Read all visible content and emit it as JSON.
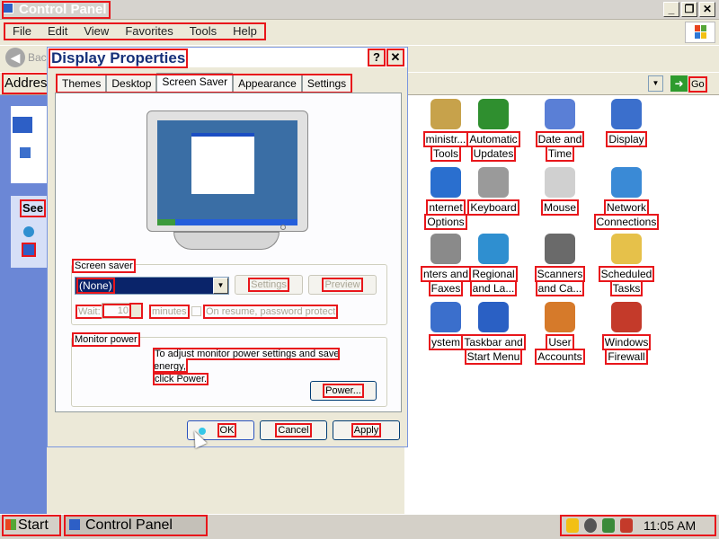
{
  "window": {
    "title": "Control Panel",
    "menus": [
      "File",
      "Edit",
      "View",
      "Favorites",
      "Tools",
      "Help"
    ],
    "back_label": "Back",
    "address_label": "Address",
    "go_label": "Go",
    "see_also_label": "See"
  },
  "control_panel_items": [
    {
      "label": "Administrative Tools",
      "display": [
        "ministr...",
        "Tools"
      ],
      "icon": "admin-tools-icon",
      "color": "#c7a24b"
    },
    {
      "label": "Automatic Updates",
      "display": [
        "Automatic",
        "Updates"
      ],
      "icon": "windows-update-icon",
      "color": "#2f8f2f"
    },
    {
      "label": "Date and Time",
      "display": [
        "Date and",
        "Time"
      ],
      "icon": "clock-icon",
      "color": "#5a7fd6"
    },
    {
      "label": "Display",
      "display": [
        "Display"
      ],
      "icon": "display-icon",
      "color": "#3b6fcc"
    },
    {
      "label": "Internet Options",
      "display": [
        "nternet",
        "Options"
      ],
      "icon": "globe-icon",
      "color": "#2a6fcf"
    },
    {
      "label": "Keyboard",
      "display": [
        "Keyboard"
      ],
      "icon": "keyboard-icon",
      "color": "#9a9a9a"
    },
    {
      "label": "Mouse",
      "display": [
        "Mouse"
      ],
      "icon": "mouse-icon",
      "color": "#d0d0d0"
    },
    {
      "label": "Network Connections",
      "display": [
        "Network",
        "Connections"
      ],
      "icon": "network-icon",
      "color": "#3a8ad6"
    },
    {
      "label": "Printers and Faxes",
      "display": [
        "nters and",
        "Faxes"
      ],
      "icon": "printer-icon",
      "color": "#8a8a8a"
    },
    {
      "label": "Regional and Language",
      "display": [
        "Regional",
        "and La..."
      ],
      "icon": "regional-icon",
      "color": "#2f8fd0"
    },
    {
      "label": "Scanners and Cameras",
      "display": [
        "Scanners",
        "and Ca..."
      ],
      "icon": "scanner-icon",
      "color": "#6a6a6a"
    },
    {
      "label": "Scheduled Tasks",
      "display": [
        "Scheduled",
        "Tasks"
      ],
      "icon": "folder-clock-icon",
      "color": "#e6c14a"
    },
    {
      "label": "System",
      "display": [
        "ystem"
      ],
      "icon": "system-icon",
      "color": "#3b6fcc"
    },
    {
      "label": "Taskbar and Start Menu",
      "display": [
        "Taskbar and",
        "Start Menu"
      ],
      "icon": "taskbar-icon",
      "color": "#2a60c4"
    },
    {
      "label": "User Accounts",
      "display": [
        "User",
        "Accounts"
      ],
      "icon": "users-icon",
      "color": "#d67a2a"
    },
    {
      "label": "Windows Firewall",
      "display": [
        "Windows",
        "Firewall"
      ],
      "icon": "firewall-icon",
      "color": "#c43a2a"
    }
  ],
  "dialog": {
    "title": "Display Properties",
    "help_label": "?",
    "close_label": "✕",
    "tabs": [
      "Themes",
      "Desktop",
      "Screen Saver",
      "Appearance",
      "Settings"
    ],
    "active_tab": "Screen Saver",
    "screen_saver": {
      "group_label": "Screen saver",
      "selected": "(None)",
      "settings_button": "Settings",
      "preview_button": "Preview",
      "wait_label": "Wait:",
      "wait_value": "10",
      "minutes_label": "minutes",
      "resume_label": "On resume, password protect"
    },
    "monitor_power": {
      "group_label": "Monitor power",
      "line1": "To adjust monitor power settings and save energy,",
      "line2": "click Power.",
      "power_button": "Power..."
    },
    "buttons": {
      "ok": "OK",
      "cancel": "Cancel",
      "apply": "Apply"
    }
  },
  "taskbar": {
    "start_label": "Start",
    "task_label": "Control Panel",
    "clock": "11:05 AM"
  }
}
